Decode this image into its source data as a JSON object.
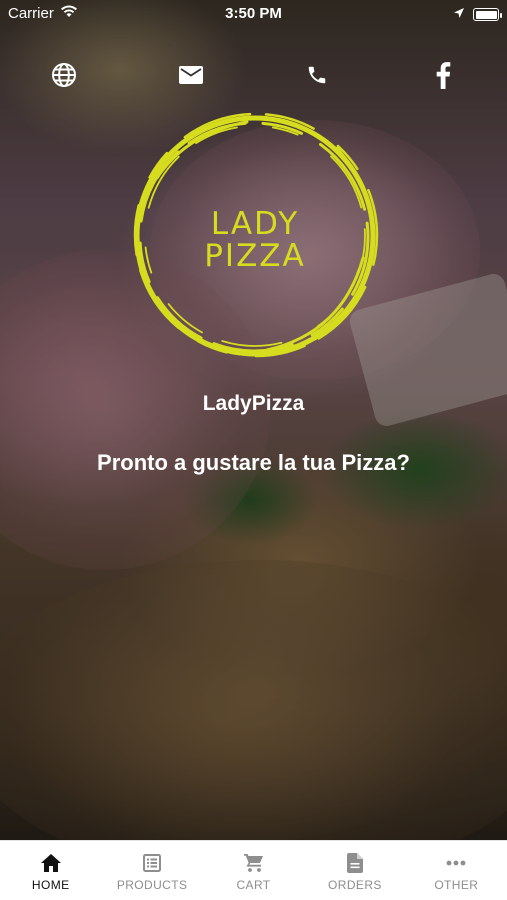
{
  "status_bar": {
    "carrier": "Carrier",
    "time": "3:50 PM"
  },
  "top_icons": [
    {
      "name": "globe-icon"
    },
    {
      "name": "mail-icon"
    },
    {
      "name": "phone-icon"
    },
    {
      "name": "facebook-icon"
    }
  ],
  "logo": {
    "line1": "LADY",
    "line2": "PIZZA",
    "ring_color": "#d6dc1e"
  },
  "content": {
    "brand_name": "LadyPizza",
    "tagline": "Pronto a gustare la tua Pizza?"
  },
  "tab_bar": {
    "active": "HOME",
    "tabs": [
      {
        "label": "HOME",
        "icon": "home-icon"
      },
      {
        "label": "PRODUCTS",
        "icon": "list-icon"
      },
      {
        "label": "CART",
        "icon": "cart-icon"
      },
      {
        "label": "ORDERS",
        "icon": "document-icon"
      },
      {
        "label": "OTHER",
        "icon": "more-icon"
      }
    ]
  }
}
